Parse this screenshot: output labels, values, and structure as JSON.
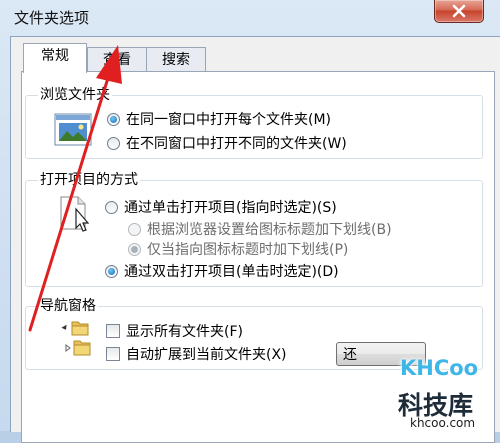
{
  "window": {
    "title": "文件夹选项",
    "close_icon": "close-x-icon"
  },
  "tabs": [
    {
      "label": "常规",
      "active": true
    },
    {
      "label": "查看",
      "active": false
    },
    {
      "label": "搜索",
      "active": false
    }
  ],
  "browse_folders": {
    "legend": "浏览文件夹",
    "icon": "folder-window-icon",
    "options": [
      {
        "label": "在同一窗口中打开每个文件夹(M)",
        "checked": true
      },
      {
        "label": "在不同窗口中打开不同的文件夹(W)",
        "checked": false
      }
    ]
  },
  "click_items": {
    "legend": "打开项目的方式",
    "icon": "pointer-document-icon",
    "options": [
      {
        "label": "通过单击打开项目(指向时选定)(S)",
        "checked": false,
        "disabled": false
      },
      {
        "label": "根据浏览器设置给图标标题加下划线(B)",
        "checked": false,
        "disabled": true
      },
      {
        "label": "仅当指向图标标题时加下划线(P)",
        "checked": true,
        "disabled": true
      },
      {
        "label": "通过双击打开项目(单击时选定)(D)",
        "checked": true,
        "disabled": false
      }
    ]
  },
  "nav_pane": {
    "legend": "导航窗格",
    "options": [
      {
        "label": "显示所有文件夹(F)",
        "checked": false
      },
      {
        "label": "自动扩展到当前文件夹(X)",
        "checked": false
      }
    ]
  },
  "restore_button": {
    "label": "还"
  },
  "watermark": {
    "logo": "KHCoo",
    "title": "科技库",
    "url": "khcoo.com"
  },
  "annotation": {
    "arrow_color": "#e02020"
  }
}
